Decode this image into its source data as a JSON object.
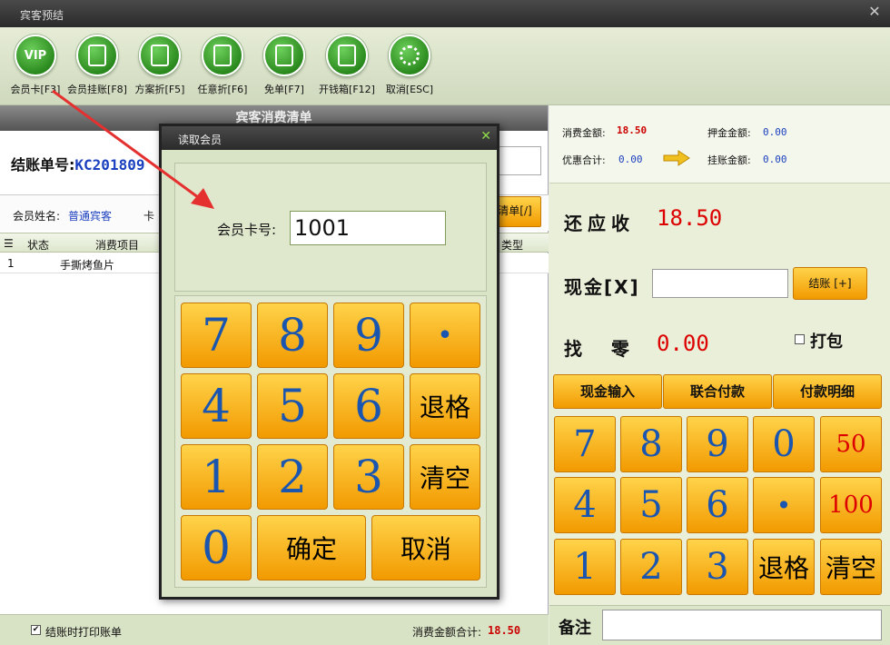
{
  "window": {
    "title": "宾客预结"
  },
  "toolbar": [
    {
      "label": "会员卡[F3]",
      "icon": "vip-card-icon",
      "glyph": "VIP"
    },
    {
      "label": "会员挂账[F8]",
      "icon": "member-charge-icon",
      "glyph": ""
    },
    {
      "label": "方案折[F5]",
      "icon": "plan-discount-icon",
      "glyph": ""
    },
    {
      "label": "任意折[F6]",
      "icon": "any-discount-icon",
      "glyph": ""
    },
    {
      "label": "免单[F7]",
      "icon": "free-order-icon",
      "glyph": ""
    },
    {
      "label": "开钱箱[F12]",
      "icon": "cash-drawer-icon",
      "glyph": ""
    },
    {
      "label": "取消[ESC]",
      "icon": "cancel-icon",
      "glyph": ""
    }
  ],
  "left": {
    "header": "宾客消费清单",
    "bill_label": "结账单号:",
    "bill_no": "KC201809",
    "member_label": "会员姓名:",
    "member_value": "普通宾客",
    "card_label": "卡",
    "clear_list": "清单[/]",
    "columns": [
      "状态",
      "消费项目",
      "类型"
    ],
    "rows": [
      {
        "index": "1",
        "status": "",
        "item": "手撕烤鱼片"
      }
    ],
    "print_label": "结账时打印账单",
    "total_label": "消费金额合计:",
    "total_value": "18.50"
  },
  "right": {
    "consume_label": "消费金额:",
    "consume_value": "18.50",
    "deposit_label": "押金金额:",
    "deposit_value": "0.00",
    "discount_label": "优惠合计:",
    "discount_value": "0.00",
    "charge_label": "挂账金额:",
    "charge_value": "0.00",
    "due_label": "还应收",
    "due_value": "18.50",
    "cash_label": "现金[X]",
    "cash_value": "",
    "settle_button": "结账 [+]",
    "change_label": "找  零",
    "change_value": "0.00",
    "pack_label": "打包",
    "tabs": [
      "现金输入",
      "联合付款",
      "付款明细"
    ],
    "keys": [
      [
        "7",
        "8",
        "9",
        "0",
        "50"
      ],
      [
        "4",
        "5",
        "6",
        "•",
        "100"
      ],
      [
        "1",
        "2",
        "3",
        "退格",
        "清空"
      ]
    ],
    "remark_label": "备注",
    "remark_value": ""
  },
  "dialog": {
    "title": "读取会员",
    "card_label": "会员卡号:",
    "card_value": "1001",
    "keys": {
      "k7": "7",
      "k8": "8",
      "k9": "9",
      "kdot": "•",
      "k4": "4",
      "k5": "5",
      "k6": "6",
      "kback": "退格",
      "k1": "1",
      "k2": "2",
      "k3": "3",
      "kclear": "清空",
      "k0": "0",
      "kok": "确定",
      "kcancel": "取消"
    }
  },
  "colors": {
    "accent_orange": "#f7a800",
    "annotation_red": "#e53030",
    "amount_red": "#cc0000",
    "link_blue": "#1a3fbf"
  }
}
